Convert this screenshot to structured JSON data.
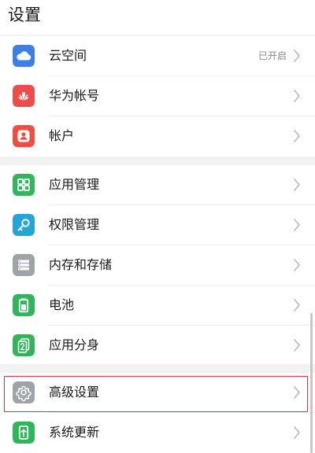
{
  "header": {
    "title": "设置"
  },
  "groups": [
    {
      "rows": [
        {
          "label": "云空间",
          "status": "已开启",
          "icon": "cloud-icon",
          "color": "#3d7fe6"
        },
        {
          "label": "华为帐号",
          "status": "",
          "icon": "huawei-logo-icon",
          "color": "#ee4b4b"
        },
        {
          "label": "帐户",
          "status": "",
          "icon": "user-icon",
          "color": "#ef4e42"
        }
      ]
    },
    {
      "rows": [
        {
          "label": "应用管理",
          "status": "",
          "icon": "apps-grid-icon",
          "color": "#34b45c"
        },
        {
          "label": "权限管理",
          "status": "",
          "icon": "key-icon",
          "color": "#25a5d6"
        },
        {
          "label": "内存和存储",
          "status": "",
          "icon": "storage-icon",
          "color": "#9ea3a8"
        },
        {
          "label": "电池",
          "status": "",
          "icon": "battery-icon",
          "color": "#2fb65a"
        },
        {
          "label": "应用分身",
          "status": "",
          "icon": "app-twin-icon",
          "color": "#32b45a"
        }
      ]
    },
    {
      "rows": [
        {
          "label": "高级设置",
          "status": "",
          "icon": "gear-icon",
          "color": "#9ea3a8"
        },
        {
          "label": "系统更新",
          "status": "",
          "icon": "system-update-icon",
          "color": "#2fb65a"
        }
      ]
    }
  ],
  "highlight_color": "#e0334a"
}
